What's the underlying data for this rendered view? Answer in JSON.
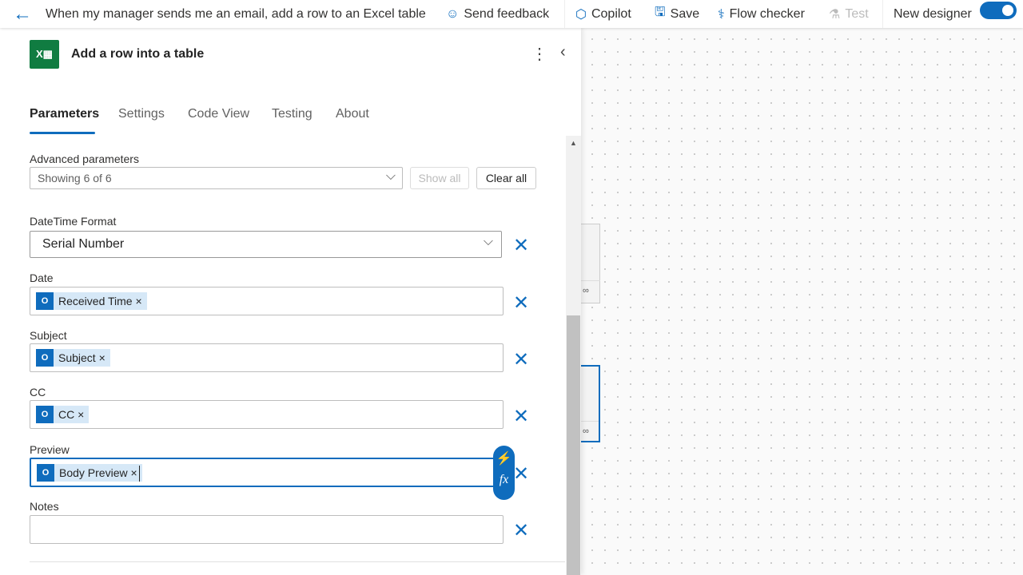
{
  "header": {
    "title": "When my manager sends me an email, add a row to an Excel table",
    "send_feedback": "Send feedback",
    "copilot": "Copilot",
    "save": "Save",
    "flow_checker": "Flow checker",
    "test": "Test",
    "new_designer": "New designer",
    "new_designer_on": true
  },
  "panel": {
    "title": "Add a row into a table",
    "tabs": [
      "Parameters",
      "Settings",
      "Code View",
      "Testing",
      "About"
    ],
    "active_tab": "Parameters",
    "advanced": {
      "label": "Advanced parameters",
      "value": "Showing 6 of 6",
      "show_all": "Show all",
      "clear_all": "Clear all"
    },
    "fields": [
      {
        "label": "DateTime Format",
        "type": "dropdown",
        "value": "Serial Number"
      },
      {
        "label": "Date",
        "token": "Received Time"
      },
      {
        "label": "Subject",
        "token": "Subject"
      },
      {
        "label": "CC",
        "token": "CC"
      },
      {
        "label": "Preview",
        "token": "Body Preview"
      },
      {
        "label": "Notes",
        "token": null
      }
    ],
    "token_remove": "×",
    "fx": "fx"
  },
  "colors": {
    "accent": "#0f6cbd",
    "excel": "#107c41"
  }
}
